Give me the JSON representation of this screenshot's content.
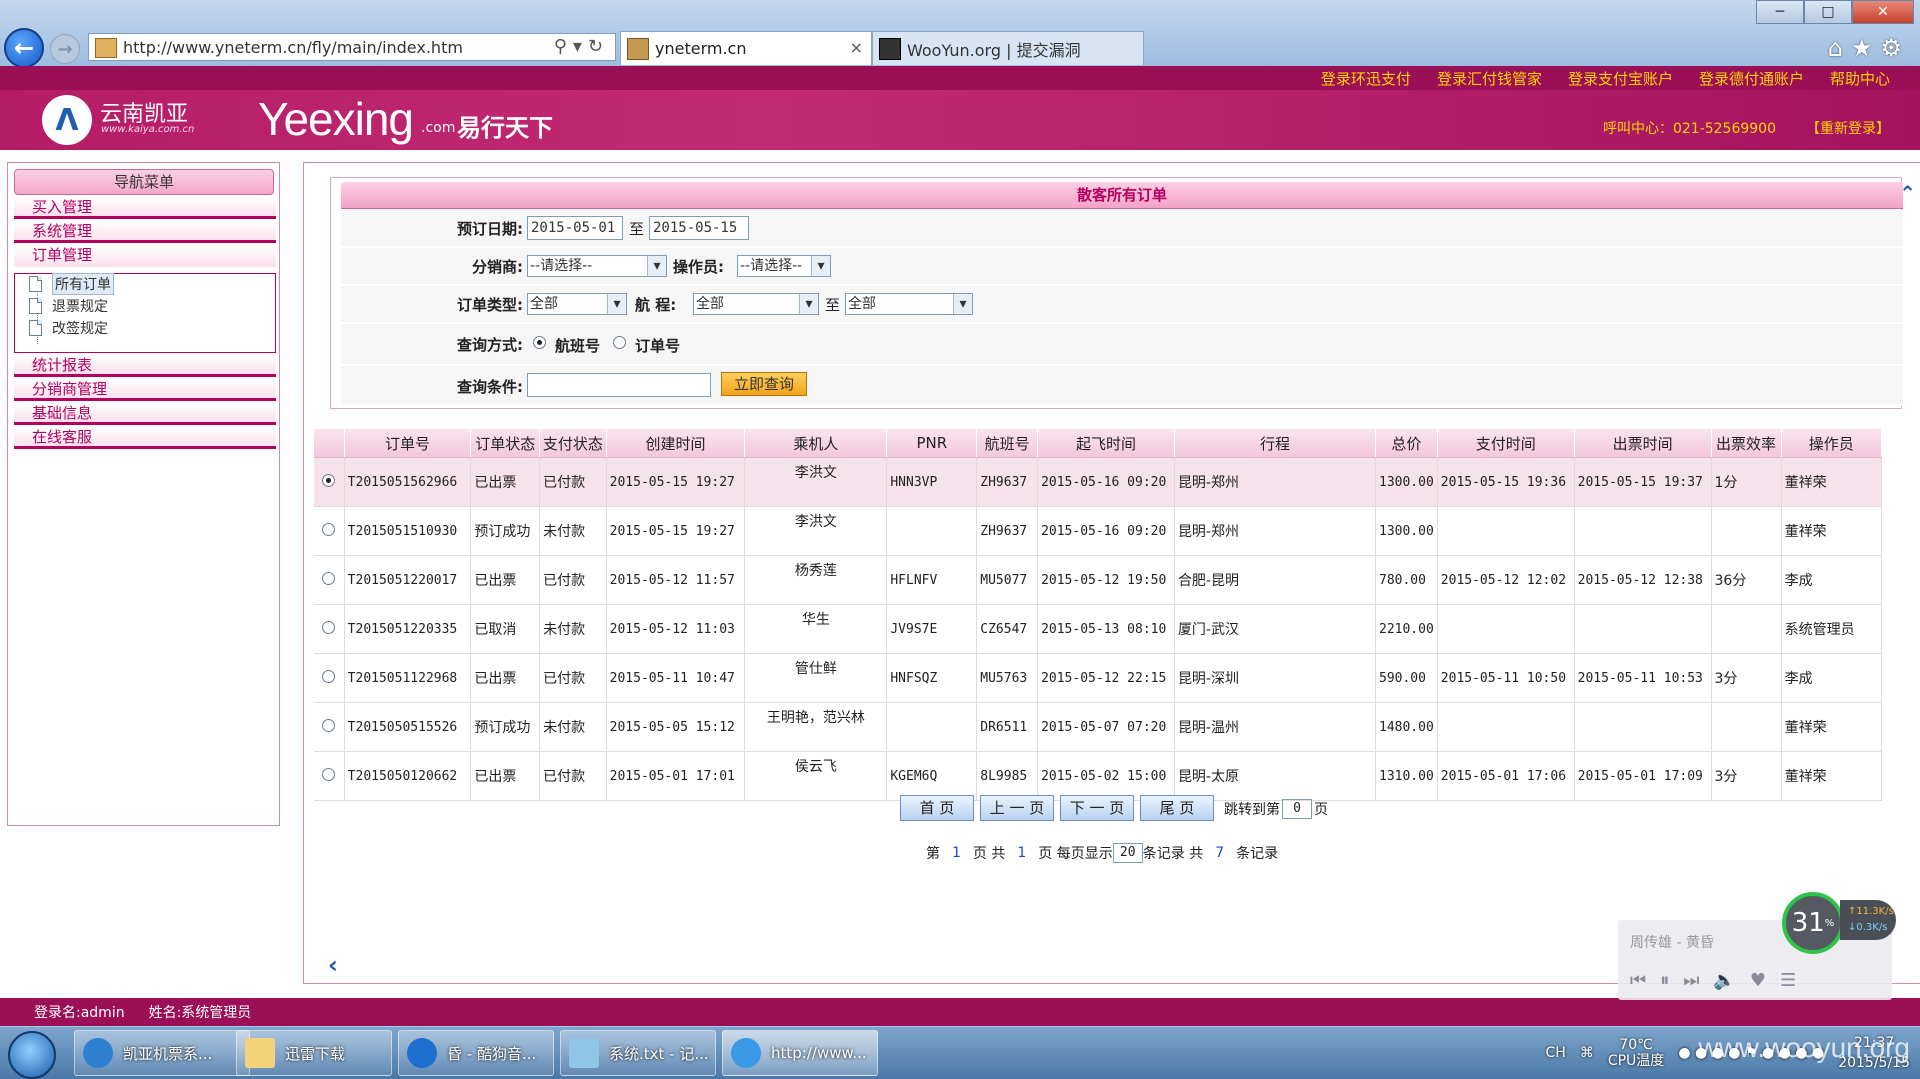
{
  "browser": {
    "address_url": "http://www.yneterm.cn/fly/main/index.htm",
    "tabs": [
      {
        "label": "yneterm.cn",
        "active": true
      },
      {
        "label": "WooYun.org | 提交漏洞",
        "active": false
      }
    ],
    "close_tab": "×"
  },
  "top_links": [
    "登录环迅支付",
    "登录汇付钱管家",
    "登录支付宝账户",
    "登录德付通账户",
    "帮助中心"
  ],
  "header": {
    "logo_text": "云南凯亚",
    "logo_sub": "www.kaiya.com.cn",
    "brand": "Yeexing",
    "brand_suffix": ".com",
    "brand_cn": "易行天下",
    "hotline": "呼叫中心：021-52569900",
    "relogin": "【重新登录】"
  },
  "sidebar": {
    "title": "导航菜单",
    "items": [
      "买入管理",
      "系统管理",
      "订单管理"
    ],
    "sub_items": [
      "所有订单",
      "退票规定",
      "改签规定"
    ],
    "items_after": [
      "统计报表",
      "分销商管理",
      "基础信息",
      "在线客服"
    ]
  },
  "form": {
    "title": "散客所有订单",
    "booking_date_label": "预订日期:",
    "date_from": "2015-05-01",
    "to_label": "至",
    "date_to": "2015-05-15",
    "distributor_label": "分销商:",
    "distributor_value": "--请选择--",
    "operator_label": "操作员:",
    "operator_value": "--请选择--",
    "order_type_label": "订单类型:",
    "order_type_value": "全部",
    "route_label": "航 程:",
    "route_from": "全部",
    "route_to": "全部",
    "query_mode_label": "查询方式:",
    "query_mode_flight": "航班号",
    "query_mode_order": "订单号",
    "condition_label": "查询条件:",
    "condition_value": "",
    "search_button": "立即查询"
  },
  "table": {
    "headers": [
      "",
      "订单号",
      "订单状态",
      "支付状态",
      "创建时间",
      "乘机人",
      "PNR",
      "航班号",
      "起飞时间",
      "行程",
      "总价",
      "支付时间",
      "出票时间",
      "出票效率",
      "操作员"
    ],
    "rows": [
      {
        "selected": true,
        "order_no": "T2015051562966",
        "status": "已出票",
        "pay": "已付款",
        "paid": true,
        "created": "2015-05-15 19:27",
        "passenger": "李洪文",
        "pnr": "HNN3VP",
        "flight": "ZH9637",
        "depart": "2015-05-16 09:20",
        "route": "昆明-郑州",
        "price": "1300.00",
        "pay_time": "2015-05-15 19:36",
        "ticket_time": "2015-05-15 19:37",
        "efficiency": "1分",
        "operator": "董祥荣"
      },
      {
        "selected": false,
        "order_no": "T2015051510930",
        "status": "预订成功",
        "pay": "未付款",
        "paid": false,
        "created": "2015-05-15 19:27",
        "passenger": "李洪文",
        "pnr": "",
        "flight": "ZH9637",
        "depart": "2015-05-16 09:20",
        "route": "昆明-郑州",
        "price": "1300.00",
        "pay_time": "",
        "ticket_time": "",
        "efficiency": "",
        "operator": "董祥荣"
      },
      {
        "selected": false,
        "order_no": "T2015051220017",
        "status": "已出票",
        "pay": "已付款",
        "paid": true,
        "created": "2015-05-12 11:57",
        "passenger": "杨秀莲",
        "pnr": "HFLNFV",
        "flight": "MU5077",
        "depart": "2015-05-12 19:50",
        "route": "合肥-昆明",
        "price": "780.00",
        "pay_time": "2015-05-12 12:02",
        "ticket_time": "2015-05-12 12:38",
        "efficiency": "36分",
        "operator": "李成"
      },
      {
        "selected": false,
        "order_no": "T2015051220335",
        "status": "已取消",
        "pay": "未付款",
        "paid": false,
        "created": "2015-05-12 11:03",
        "passenger": "华生",
        "pnr": "JV9S7E",
        "flight": "CZ6547",
        "depart": "2015-05-13 08:10",
        "route": "厦门-武汉",
        "price": "2210.00",
        "pay_time": "",
        "ticket_time": "",
        "efficiency": "",
        "operator": "系统管理员"
      },
      {
        "selected": false,
        "order_no": "T2015051122968",
        "status": "已出票",
        "pay": "已付款",
        "paid": true,
        "created": "2015-05-11 10:47",
        "passenger": "管仕鲜",
        "pnr": "HNFSQZ",
        "flight": "MU5763",
        "depart": "2015-05-12 22:15",
        "route": "昆明-深圳",
        "price": "590.00",
        "pay_time": "2015-05-11 10:50",
        "ticket_time": "2015-05-11 10:53",
        "efficiency": "3分",
        "operator": "李成"
      },
      {
        "selected": false,
        "order_no": "T2015050515526",
        "status": "预订成功",
        "pay": "未付款",
        "paid": false,
        "created": "2015-05-05 15:12",
        "passenger": "王明艳，范兴林",
        "pnr": "",
        "flight": "DR6511",
        "depart": "2015-05-07 07:20",
        "route": "昆明-温州",
        "price": "1480.00",
        "pay_time": "",
        "ticket_time": "",
        "efficiency": "",
        "operator": "董祥荣"
      },
      {
        "selected": false,
        "order_no": "T2015050120662",
        "status": "已出票",
        "pay": "已付款",
        "paid": true,
        "created": "2015-05-01 17:01",
        "passenger": "侯云飞",
        "pnr": "KGEM6Q",
        "flight": "8L9985",
        "depart": "2015-05-02 15:00",
        "route": "昆明-太原",
        "price": "1310.00",
        "pay_time": "2015-05-01 17:06",
        "ticket_time": "2015-05-01 17:09",
        "efficiency": "3分",
        "operator": "董祥荣"
      }
    ]
  },
  "pagination": {
    "first": "首 页",
    "prev": "上 一 页",
    "next": "下 一 页",
    "last": "尾 页",
    "jump_prefix": "跳转到第",
    "jump_value": "0",
    "jump_suffix": "页",
    "info_page_prefix": "第",
    "current_page": "1",
    "info_total_prefix": "页 共",
    "total_pages": "1",
    "info_per_page": "页 每页显示",
    "per_page": "20",
    "info_records": "条记录  共",
    "total_records": "7",
    "info_records_suffix": "条记录"
  },
  "statusbar": {
    "login": "登录名:admin",
    "name": "姓名:系统管理员"
  },
  "music": {
    "title": "周传雄 - 黄昏",
    "gauge": "31",
    "gauge_unit": "%",
    "up_speed": "↑11.3K/s",
    "down_speed": "↓0.3K/s"
  },
  "taskbar": {
    "tasks": [
      "凯亚机票系...",
      "迅雷下载",
      "昏 - 酷狗音...",
      "系统.txt - 记...",
      "http://www..."
    ],
    "lang": "CH",
    "temp": "70℃",
    "temp_label": "CPU温度",
    "time": "21:37",
    "date": "2015/5/15",
    "watermark": "www.wooyun.org"
  },
  "colors": {
    "accent": "#b3005f",
    "header": "#c22b73",
    "link_yellow": "#ffd400",
    "paid": "#1f45d6",
    "unpaid": "#e00000"
  }
}
